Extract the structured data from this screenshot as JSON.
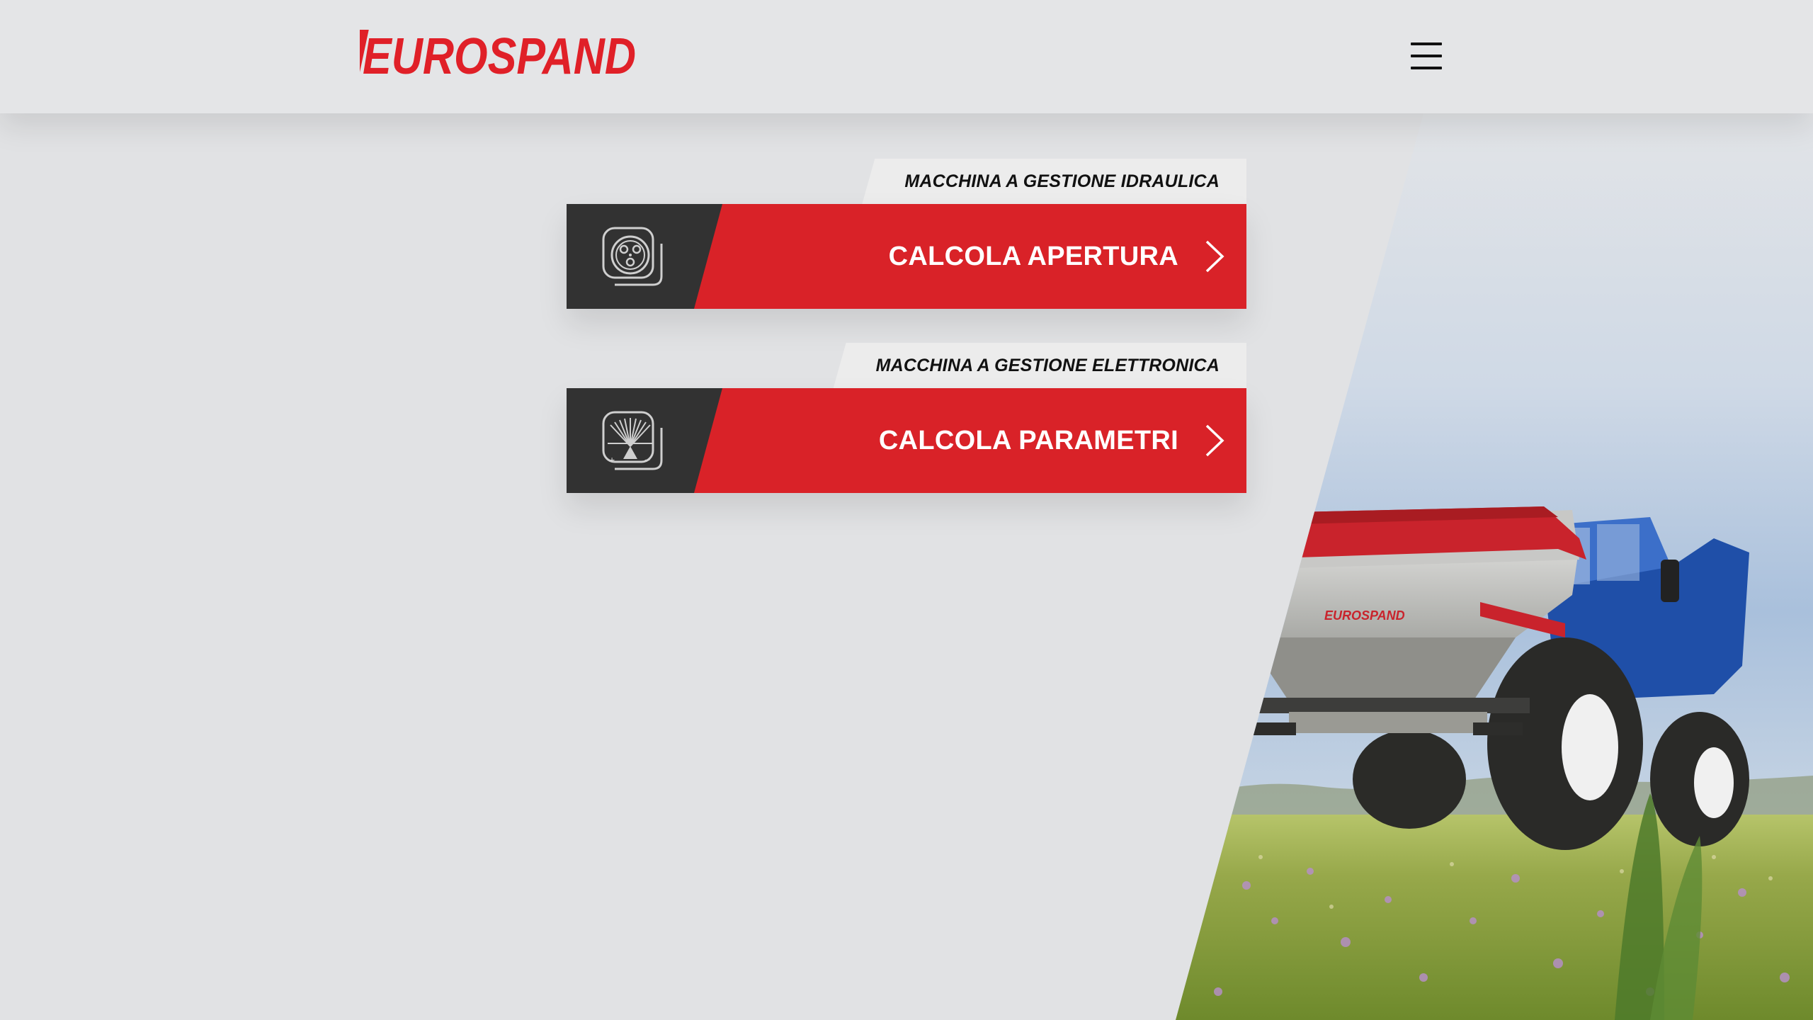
{
  "header": {
    "logo_text": "EUROSPAND",
    "menu_icon": "hamburger-menu-icon"
  },
  "cards": [
    {
      "tag": "MACCHINA A GESTIONE IDRAULICA",
      "label": "CALCOLA APERTURA",
      "icon": "hydraulic-disc-icon"
    },
    {
      "tag": "MACCHINA A GESTIONE ELETTRONICA",
      "label": "CALCOLA PARAMETRI",
      "icon": "spreader-parameters-icon"
    }
  ],
  "hero_image": {
    "subject": "tractor-with-fertilizer-spreader-photo",
    "brand_on_machine": "EUROSPAND"
  },
  "colors": {
    "brand_red": "#d92228",
    "dark_panel": "#323232",
    "background": "#e1e2e4"
  }
}
